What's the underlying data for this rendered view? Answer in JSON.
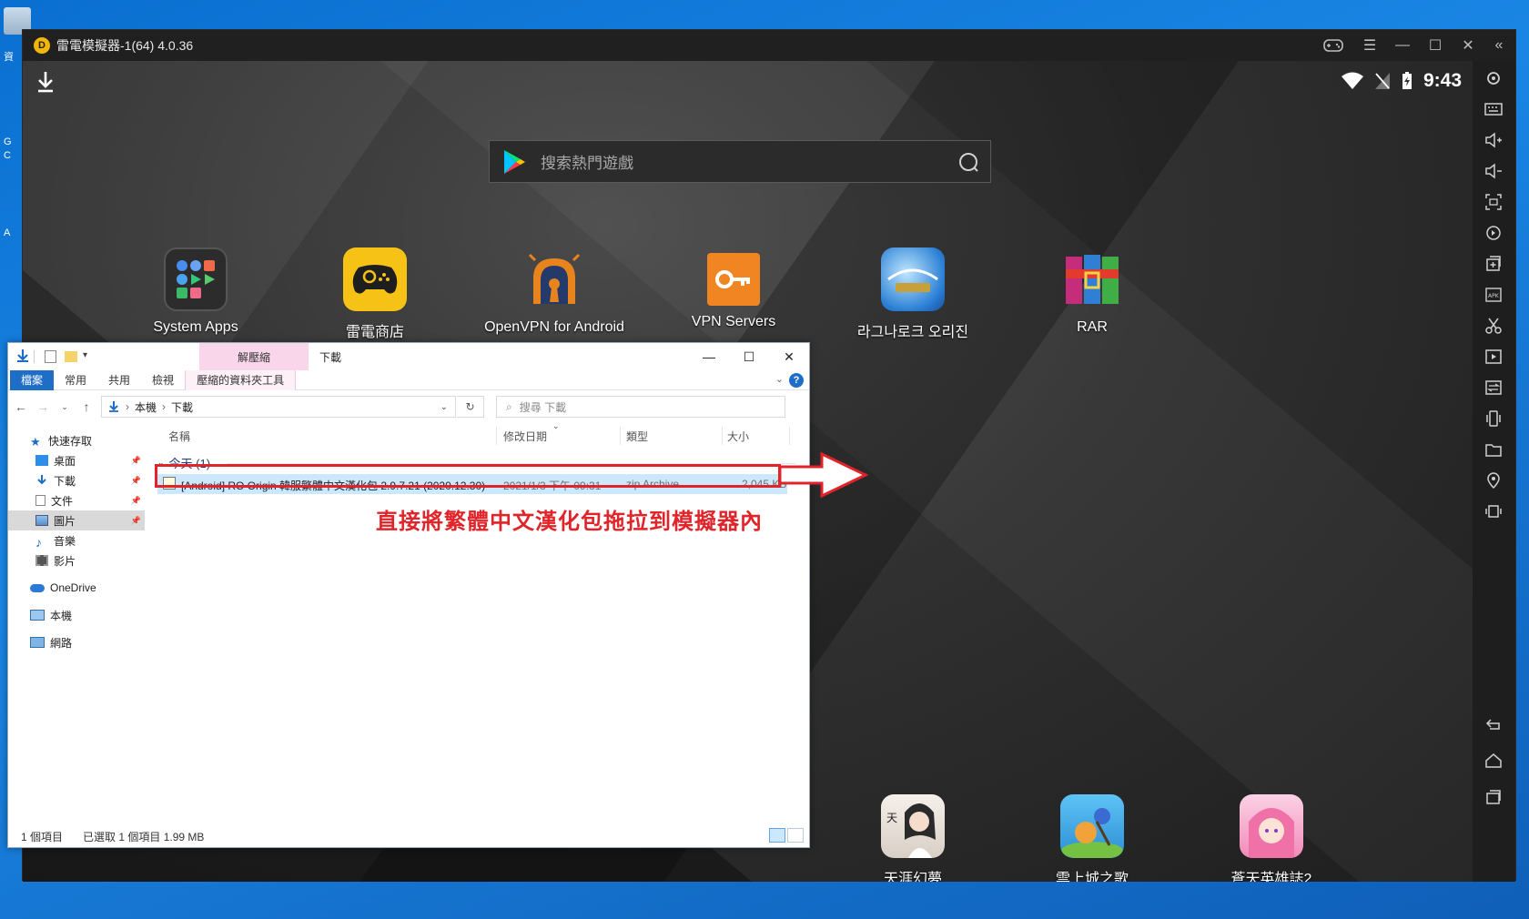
{
  "desktop": {
    "icon_labels": [
      "資",
      "G",
      "C",
      "A"
    ]
  },
  "emulator": {
    "title": "雷電模擬器-1(64) 4.0.36",
    "logo_glyph": "D",
    "status": {
      "time": "9:43"
    },
    "search": {
      "placeholder": "搜索熱門遊戲"
    },
    "apps": [
      {
        "label": "System Apps",
        "icon": "system-apps-folder-icon"
      },
      {
        "label": "雷電商店",
        "icon": "ld-store-gamepad-icon"
      },
      {
        "label": "OpenVPN for Android",
        "icon": "openvpn-icon"
      },
      {
        "label": "VPN Servers",
        "icon": "vpn-key-icon"
      },
      {
        "label": "라그나로크 오리진",
        "icon": "ragnarok-origin-icon"
      },
      {
        "label": "RAR",
        "icon": "rar-books-icon"
      }
    ],
    "bottom_apps": [
      {
        "label": "天涯幻夢",
        "icon": "tianya-game-icon"
      },
      {
        "label": "雲上城之歌",
        "icon": "cloud-city-game-icon"
      },
      {
        "label": "蒼天英雄誌2",
        "icon": "hero-game-icon"
      }
    ],
    "colors": {
      "accent": "#f2b705",
      "background": "#1b1b1b"
    }
  },
  "explorer": {
    "context_tab_group": "解壓縮",
    "caption": "下載",
    "tabs": [
      "檔案",
      "常用",
      "共用",
      "檢視",
      "壓縮的資料夾工具"
    ],
    "address": {
      "root": "本機",
      "current": "下載"
    },
    "search_placeholder": "搜尋 下載",
    "nav": {
      "quick_access": "快速存取",
      "items": [
        "桌面",
        "下載",
        "文件",
        "圖片",
        "音樂",
        "影片"
      ],
      "onedrive": "OneDrive",
      "this_pc": "本機",
      "network": "網路"
    },
    "columns": {
      "name": "名稱",
      "modified": "修改日期",
      "type": "類型",
      "size": "大小"
    },
    "group": "今天 (1)",
    "file": {
      "name": "[Android] RO Origin 韓服繁體中文漢化包 2.9.7.21 (2020.12.30)",
      "modified": "2021/1/3 下午 09:31",
      "type": "zip Archive",
      "size": "2,045 KB"
    },
    "status": {
      "count": "1 個項目",
      "selected": "已選取 1 個項目  1.99 MB"
    }
  },
  "annotation": {
    "text": "直接將繁體中文漢化包拖拉到模擬器內",
    "color": "#e0242a"
  }
}
